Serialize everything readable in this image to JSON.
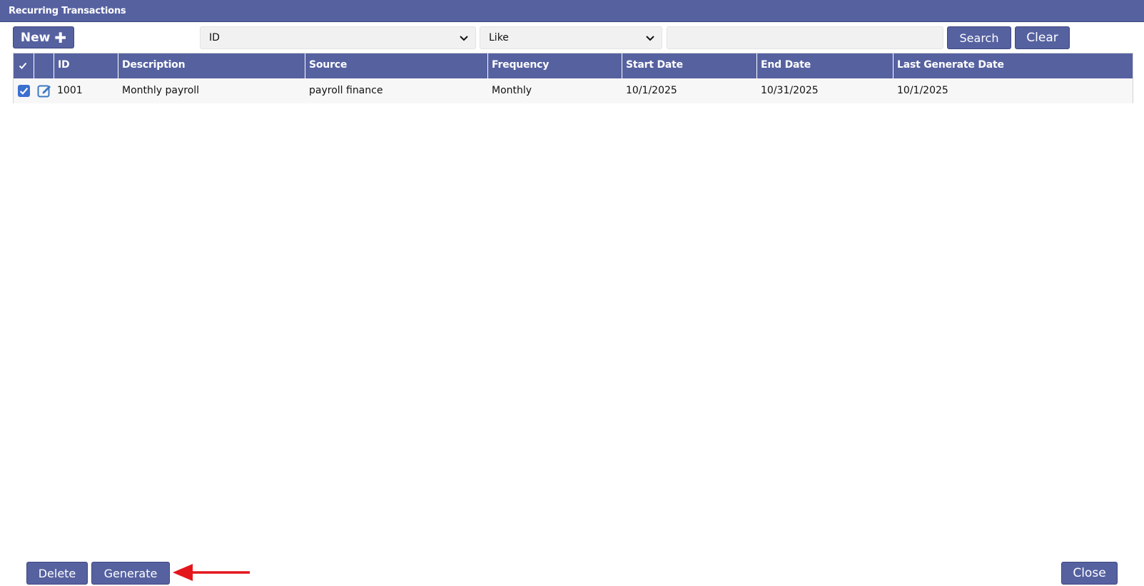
{
  "window": {
    "title": "Recurring Transactions"
  },
  "toolbar": {
    "new_label": "New",
    "new_icon": "plus-icon",
    "field_select_value": "ID",
    "operator_select_value": "Like",
    "search_placeholder": "",
    "search_label": "Search",
    "clear_label": "Clear"
  },
  "table": {
    "select_all_icon": "checkmark-icon",
    "columns": [
      "ID",
      "Description",
      "Source",
      "Frequency",
      "Start Date",
      "End Date",
      "Last Generate Date"
    ],
    "rows": [
      {
        "checked": true,
        "edit_icon": "edit-icon",
        "id": "1001",
        "description": "Monthly payroll",
        "source": "payroll finance",
        "frequency": "Monthly",
        "start_date": "10/1/2025",
        "end_date": "10/31/2025",
        "last_generate_date": "10/1/2025"
      }
    ]
  },
  "footer": {
    "delete_label": "Delete",
    "generate_label": "Generate",
    "close_label": "Close"
  },
  "annotation": {
    "arrow_icon": "red-arrow-icon",
    "arrow_color": "#e3161c"
  },
  "colors": {
    "header_bg": "#5661a0",
    "button_bg": "#5661a0",
    "input_bg": "#f1f1f1",
    "checkbox": "#3b6fd0",
    "edit_icon": "#3b78c4"
  }
}
